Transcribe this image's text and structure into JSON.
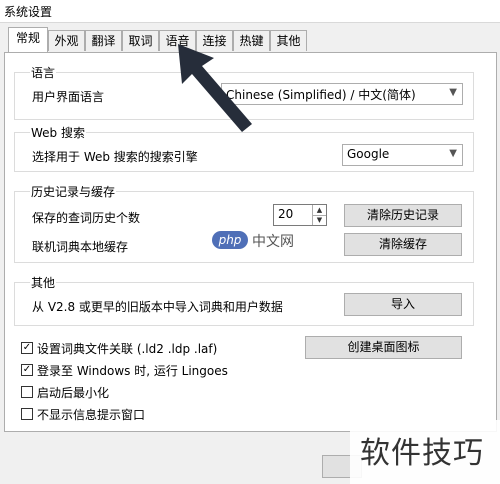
{
  "window": {
    "title": "系统设置"
  },
  "tabs": [
    {
      "label": "常规",
      "active": true
    },
    {
      "label": "外观",
      "active": false
    },
    {
      "label": "翻译",
      "active": false
    },
    {
      "label": "取词",
      "active": false
    },
    {
      "label": "语音",
      "active": false
    },
    {
      "label": "连接",
      "active": false
    },
    {
      "label": "热键",
      "active": false
    },
    {
      "label": "其他",
      "active": false
    }
  ],
  "language": {
    "group_title": "语言",
    "label": "用户界面语言",
    "value": "Chinese (Simplified)  /  中文(简体)"
  },
  "web_search": {
    "group_title": "Web 搜索",
    "label": "选择用于 Web 搜索的搜索引擎",
    "value": "Google"
  },
  "history": {
    "group_title": "历史记录与缓存",
    "count_label": "保存的查词历史个数",
    "count_value": "20",
    "clear_history_button": "清除历史记录",
    "cache_label": "联机词典本地缓存",
    "clear_cache_button": "清除缓存"
  },
  "other": {
    "group_title": "其他",
    "import_label": "从 V2.8 或更早的旧版本中导入词典和用户数据",
    "import_button": "导入"
  },
  "options": {
    "file_assoc": {
      "label": "设置词典文件关联 (.ld2 .ldp .laf)",
      "checked": true
    },
    "create_shortcut_button": "创建桌面图标",
    "run_on_login": {
      "label": "登录至 Windows 时, 运行 Lingoes",
      "checked": true
    },
    "minimize_on_start": {
      "label": "启动后最小化",
      "checked": false
    },
    "no_tips": {
      "label": "不显示信息提示窗口",
      "checked": false
    }
  },
  "watermark": {
    "php_badge": "php",
    "php_site": "中文网",
    "corner_text": "软件技巧"
  }
}
